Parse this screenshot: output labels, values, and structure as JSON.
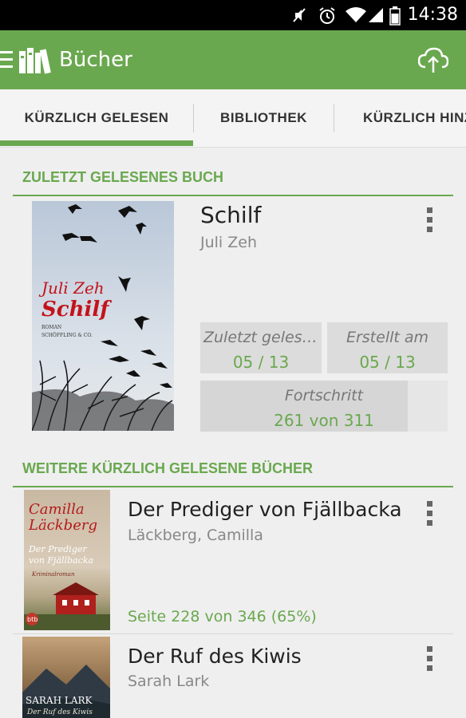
{
  "status_bar": {
    "time": "14:38"
  },
  "app_bar": {
    "title": "Bücher"
  },
  "tabs": [
    {
      "label": "KÜRZLICH GELESEN",
      "active": true
    },
    {
      "label": "BIBLIOTHEK",
      "active": false
    },
    {
      "label": "KÜRZLICH HINZ",
      "active": false
    }
  ],
  "featured": {
    "section_title": "ZULETZT GELESENES BUCH",
    "book": {
      "title": "Schilf",
      "author": "Juli Zeh",
      "cover_author": "Juli Zeh",
      "cover_title": "Schilf",
      "cover_small1": "ROMAN",
      "cover_small2": "SCHÖFFLING & CO."
    },
    "last_read": {
      "label": "Zuletzt gelesen am",
      "value": "05 / 13"
    },
    "created": {
      "label": "Erstellt am",
      "value": "05 / 13"
    },
    "progress": {
      "label": "Fortschritt",
      "value": "261 von 311",
      "fraction": 0.839
    }
  },
  "recent": {
    "section_title": "WEITERE KÜRZLICH GELESENE BÜCHER",
    "items": [
      {
        "title": "Der Prediger von Fjällbacka",
        "author": "Läckberg, Camilla",
        "progress": "Seite 228 von 346 (65%)",
        "cover_line1": "Camilla",
        "cover_line2": "Läckberg",
        "cover_line3": "Der Prediger",
        "cover_line4": "von Fjällbacka",
        "cover_line5": "Kriminalroman",
        "cover_badge": "btb"
      },
      {
        "title": "Der Ruf des Kiwis",
        "author": "Sarah Lark",
        "cover_line1": "SARAH LARK",
        "cover_line2": "Der Ruf des Kiwis"
      }
    ]
  },
  "colors": {
    "accent": "#6aa84f",
    "status_bar": "#000000",
    "background": "#efefef"
  },
  "icons": [
    "wifi-icon",
    "signal-icon",
    "battery-icon",
    "alarm-icon",
    "mute-icon",
    "menu-icon",
    "library-logo-icon",
    "cloud-sync-icon",
    "overflow-menu-icon"
  ]
}
